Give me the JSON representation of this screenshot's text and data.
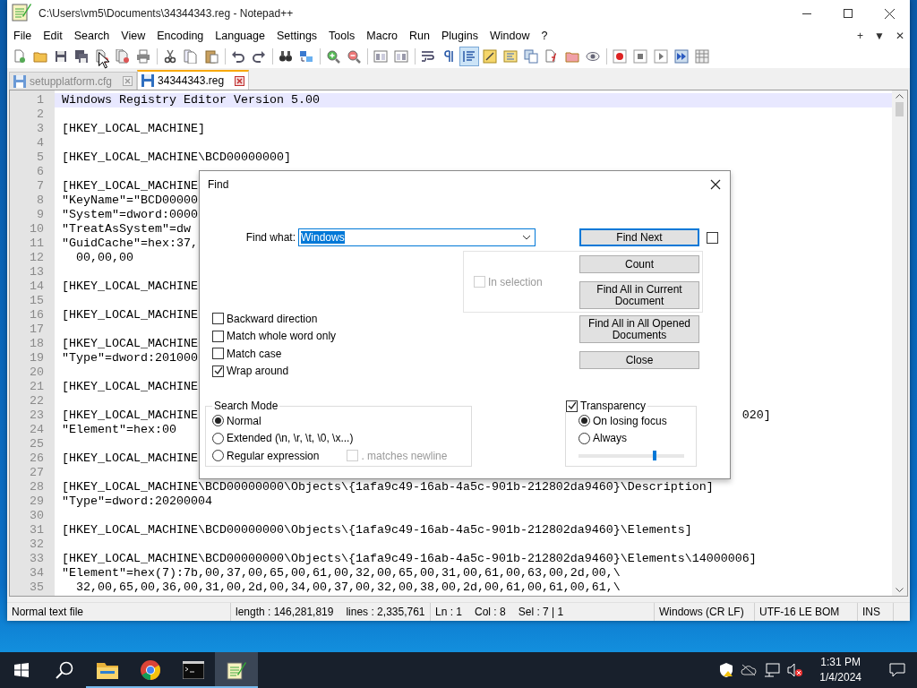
{
  "window": {
    "title": "C:\\Users\\vm5\\Documents\\34344343.reg - Notepad++"
  },
  "menu": [
    "File",
    "Edit",
    "Search",
    "View",
    "Encoding",
    "Language",
    "Settings",
    "Tools",
    "Macro",
    "Run",
    "Plugins",
    "Window",
    "?"
  ],
  "menu_right": [
    "+",
    "▼",
    "✕"
  ],
  "toolbar": [
    {
      "pressed": false
    },
    {
      "pressed": false
    },
    {
      "pressed": false
    },
    {
      "pressed": false
    },
    {
      "pressed": false
    },
    {
      "pressed": false
    },
    {
      "pressed": false
    },
    {
      "pressed": false
    },
    {
      "pressed": false
    },
    {
      "pressed": false
    },
    {
      "pressed": false
    },
    {
      "pressed": false
    },
    {
      "pressed": false
    },
    {
      "pressed": false
    },
    {
      "pressed": false
    },
    {
      "pressed": false
    },
    {
      "pressed": false
    },
    {
      "pressed": false
    },
    {
      "pressed": false
    },
    {
      "pressed": false
    },
    {
      "pressed": true
    },
    {
      "pressed": false
    },
    {
      "pressed": false
    },
    {
      "pressed": false
    },
    {
      "pressed": false
    },
    {
      "pressed": false
    },
    {
      "pressed": false
    },
    {
      "pressed": false
    },
    {
      "pressed": false
    },
    {
      "pressed": false
    },
    {
      "pressed": false
    },
    {
      "pressed": false
    }
  ],
  "tabs": [
    {
      "label": "setupplatform.cfg",
      "selected": false
    },
    {
      "label": "34344343.reg",
      "selected": true
    }
  ],
  "editor": {
    "lines": [
      {
        "number": "1",
        "text": "Windows Registry Editor Version 5.00",
        "current": true
      },
      {
        "number": "2",
        "current": false
      },
      {
        "number": "3",
        "text": "[HKEY_LOCAL_MACHINE]",
        "current": false
      },
      {
        "number": "4",
        "current": false
      },
      {
        "number": "5",
        "text": "[HKEY_LOCAL_MACHINE\\BCD00000000]",
        "current": false
      },
      {
        "number": "6",
        "current": false
      },
      {
        "number": "7",
        "text": "[HKEY_LOCAL_MACHINE",
        "current": false
      },
      {
        "number": "8",
        "text": "\"KeyName\"=\"BCD00000",
        "current": false
      },
      {
        "number": "9",
        "text": "\"System\"=dword:0000",
        "current": false
      },
      {
        "number": "10",
        "text": "\"TreatAsSystem\"=dw",
        "current": false
      },
      {
        "number": "11",
        "text": "\"GuidCache\"=hex:37,",
        "current": false
      },
      {
        "number": "12",
        "text": "  00,00,00",
        "current": false
      },
      {
        "number": "13",
        "current": false
      },
      {
        "number": "14",
        "text": "[HKEY_LOCAL_MACHINE",
        "current": false
      },
      {
        "number": "15",
        "current": false
      },
      {
        "number": "16",
        "text": "[HKEY_LOCAL_MACHINE",
        "current": false
      },
      {
        "number": "17",
        "current": false
      },
      {
        "number": "18",
        "text": "[HKEY_LOCAL_MACHINE",
        "current": false
      },
      {
        "number": "19",
        "text": "\"Type\"=dword:201000",
        "current": false
      },
      {
        "number": "20",
        "current": false
      },
      {
        "number": "21",
        "text": "[HKEY_LOCAL_MACHINE",
        "current": false
      },
      {
        "number": "22",
        "current": false
      },
      {
        "number": "23",
        "text": "[HKEY_LOCAL_MACHINE",
        "tail": "020]",
        "current": false
      },
      {
        "number": "24",
        "text": "\"Element\"=hex:00",
        "current": false
      },
      {
        "number": "25",
        "current": false
      },
      {
        "number": "26",
        "text": "[HKEY_LOCAL_MACHINE",
        "current": false
      },
      {
        "number": "27",
        "current": false
      },
      {
        "number": "28",
        "text": "[HKEY_LOCAL_MACHINE\\BCD00000000\\Objects\\{1afa9c49-16ab-4a5c-901b-212802da9460}\\Description]",
        "current": false
      },
      {
        "number": "29",
        "text": "\"Type\"=dword:20200004",
        "current": false
      },
      {
        "number": "30",
        "current": false
      },
      {
        "number": "31",
        "text": "[HKEY_LOCAL_MACHINE\\BCD00000000\\Objects\\{1afa9c49-16ab-4a5c-901b-212802da9460}\\Elements]",
        "current": false
      },
      {
        "number": "32",
        "current": false
      },
      {
        "number": "33",
        "text": "[HKEY_LOCAL_MACHINE\\BCD00000000\\Objects\\{1afa9c49-16ab-4a5c-901b-212802da9460}\\Elements\\14000006]",
        "current": false
      },
      {
        "number": "34",
        "text": "\"Element\"=hex(7):7b,00,37,00,65,00,61,00,32,00,65,00,31,00,61,00,63,00,2d,00,\\",
        "current": false
      },
      {
        "number": "35",
        "text": "  32,00,65,00,36,00,31,00,2d,00,34,00,37,00,32,00,38,00,2d,00,61,00,61,00,61,\\",
        "current": false
      }
    ]
  },
  "find_dialog": {
    "title": "Find",
    "find_what": {
      "label": "Find what:",
      "value": "Windows",
      "text_selected": true
    },
    "find_next_option": {
      "checked": false
    },
    "buttons": [
      {
        "label": "Find Next",
        "default": true
      },
      {
        "label": "Count",
        "default": false
      },
      {
        "label": "Find All in Current Document",
        "default": false
      },
      {
        "label": "Find All in All Opened Documents",
        "default": false
      },
      {
        "label": "Close",
        "default": false
      }
    ],
    "in_selection": {
      "label": "In selection",
      "checked": false,
      "disabled": true
    },
    "options": [
      {
        "label": "Backward direction",
        "checked": false
      },
      {
        "label": "Match whole word only",
        "checked": false
      },
      {
        "label": "Match case",
        "checked": false
      },
      {
        "label": "Wrap around",
        "checked": true
      }
    ],
    "search_mode": {
      "title": "Search Mode",
      "options": [
        {
          "label": "Normal",
          "selected": true
        },
        {
          "label": "Extended (\\n, \\r, \\t, \\0, \\x...)",
          "selected": false
        },
        {
          "label": "Regular expression",
          "selected": false
        }
      ],
      "matches_newline": {
        "label": ". matches newline",
        "checked": false,
        "disabled": true
      }
    },
    "transparency": {
      "label": "Transparency",
      "checked": true,
      "options": [
        {
          "label": "On losing focus",
          "selected": true
        },
        {
          "label": "Always",
          "selected": false
        }
      ],
      "level": 0.72
    }
  },
  "status_bar": {
    "file_type": "Normal text file",
    "length": "length : 146,281,819",
    "lines": "lines : 2,335,761",
    "ln": "Ln : 1",
    "col": "Col : 8",
    "sel": "Sel : 7 | 1",
    "eol": "Windows (CR LF)",
    "encoding": "UTF-16 LE BOM",
    "mode": "INS"
  },
  "taskbar": {
    "apps": [
      {
        "kind": "folder",
        "running": true,
        "selected": false
      },
      {
        "kind": "browser",
        "running": true,
        "selected": false
      },
      {
        "kind": "terminal",
        "running": true,
        "selected": false
      },
      {
        "kind": "notepad",
        "running": true,
        "selected": true
      }
    ],
    "time": "1:31 PM",
    "date": "1/4/2024"
  }
}
